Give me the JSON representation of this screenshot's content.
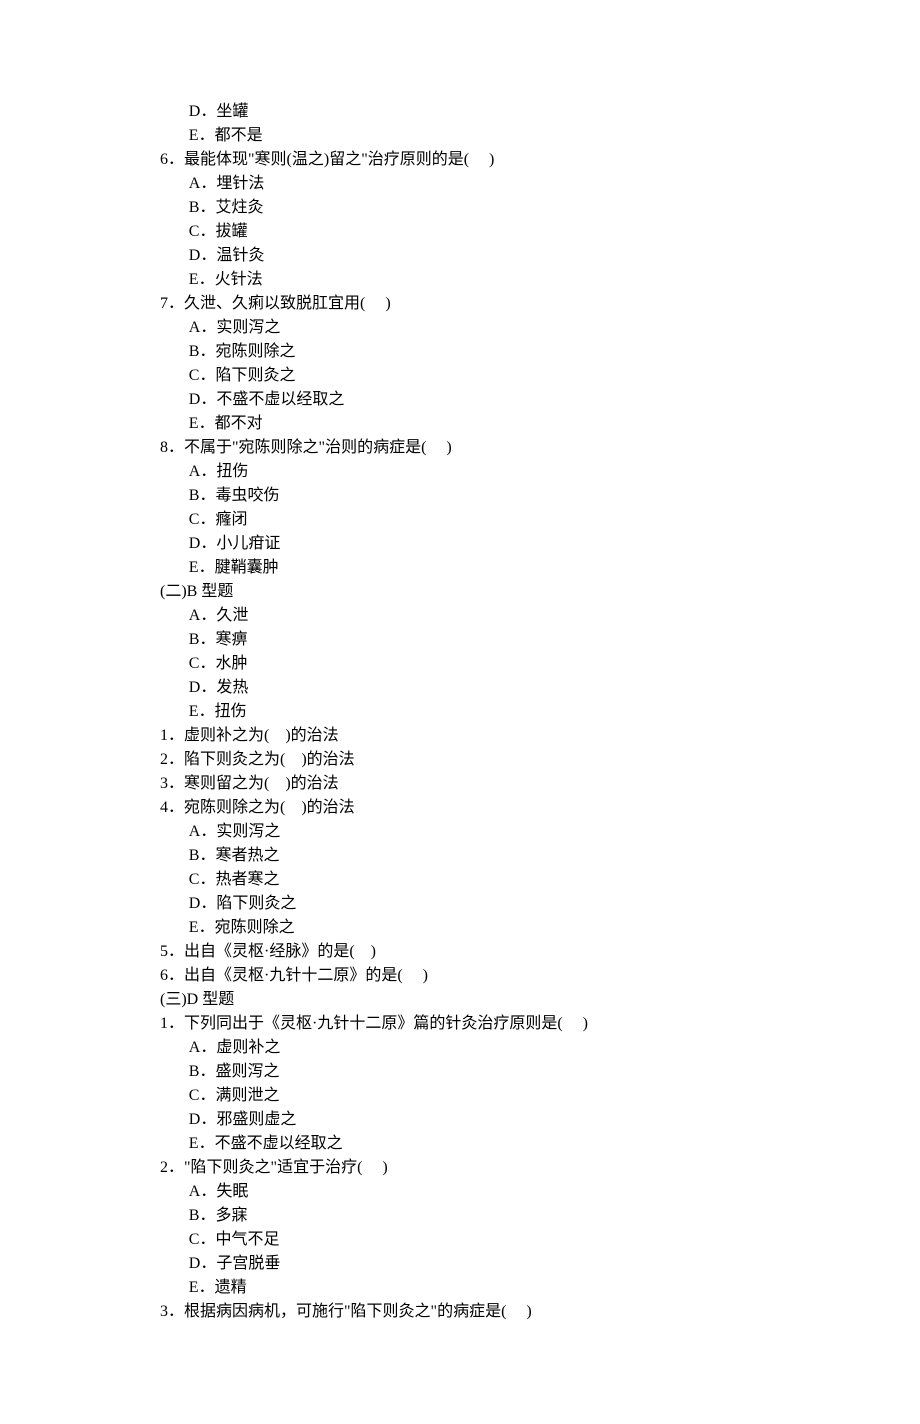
{
  "lines": [
    {
      "indent": 4,
      "text": "D．坐罐"
    },
    {
      "indent": 4,
      "text": "E．都不是"
    },
    {
      "indent": 0,
      "text": "6．最能体现\"寒则(温之)留之\"治疗原则的是(     )"
    },
    {
      "indent": 4,
      "text": "A．埋针法"
    },
    {
      "indent": 4,
      "text": "B．艾炷灸"
    },
    {
      "indent": 4,
      "text": "C．拔罐"
    },
    {
      "indent": 4,
      "text": "D．温针灸"
    },
    {
      "indent": 4,
      "text": "E．火针法"
    },
    {
      "indent": 0,
      "text": "7．久泄、久痢以致脱肛宜用(     )"
    },
    {
      "indent": 4,
      "text": "A．实则泻之"
    },
    {
      "indent": 4,
      "text": "B．宛陈则除之"
    },
    {
      "indent": 4,
      "text": "C．陷下则灸之"
    },
    {
      "indent": 4,
      "text": "D．不盛不虚以经取之"
    },
    {
      "indent": 4,
      "text": "E．都不对"
    },
    {
      "indent": 0,
      "text": "8．不属于\"宛陈则除之\"治则的病症是(     )"
    },
    {
      "indent": 4,
      "text": "A．扭伤"
    },
    {
      "indent": 4,
      "text": "B．毒虫咬伤"
    },
    {
      "indent": 4,
      "text": "C．癃闭"
    },
    {
      "indent": 4,
      "text": "D．小儿疳证"
    },
    {
      "indent": 4,
      "text": "E．腱鞘囊肿"
    },
    {
      "indent": 0,
      "text": "(二)B 型题"
    },
    {
      "indent": 4,
      "text": "A．久泄"
    },
    {
      "indent": 4,
      "text": "B．寒痹"
    },
    {
      "indent": 4,
      "text": "C．水肿"
    },
    {
      "indent": 4,
      "text": "D．发热"
    },
    {
      "indent": 4,
      "text": "E．扭伤"
    },
    {
      "indent": 0,
      "text": "1．虚则补之为(    )的治法"
    },
    {
      "indent": 0,
      "text": "2．陷下则灸之为(    )的治法"
    },
    {
      "indent": 0,
      "text": "3．寒则留之为(    )的治法"
    },
    {
      "indent": 0,
      "text": "4．宛陈则除之为(    )的治法"
    },
    {
      "indent": 4,
      "text": "A．实则泻之"
    },
    {
      "indent": 4,
      "text": "B．寒者热之"
    },
    {
      "indent": 4,
      "text": "C．热者寒之"
    },
    {
      "indent": 4,
      "text": "D．陷下则灸之"
    },
    {
      "indent": 4,
      "text": "E．宛陈则除之"
    },
    {
      "indent": 0,
      "text": "5．出自《灵枢·经脉》的是(    )"
    },
    {
      "indent": 0,
      "text": "6．出自《灵枢·九针十二原》的是(     )"
    },
    {
      "indent": 0,
      "text": "(三)D 型题"
    },
    {
      "indent": 0,
      "text": "1．下列同出于《灵枢·九针十二原》篇的针灸治疗原则是(     )"
    },
    {
      "indent": 4,
      "text": "A．虚则补之"
    },
    {
      "indent": 4,
      "text": "B．盛则泻之"
    },
    {
      "indent": 4,
      "text": "C．满则泄之"
    },
    {
      "indent": 4,
      "text": "D．邪盛则虚之"
    },
    {
      "indent": 4,
      "text": "E．不盛不虚以经取之"
    },
    {
      "indent": 0,
      "text": "2．\"陷下则灸之\"适宜于治疗(     )"
    },
    {
      "indent": 4,
      "text": "A．失眠"
    },
    {
      "indent": 4,
      "text": "B．多寐"
    },
    {
      "indent": 4,
      "text": "C．中气不足"
    },
    {
      "indent": 4,
      "text": "D．子宫脱垂"
    },
    {
      "indent": 4,
      "text": "E．遗精"
    },
    {
      "indent": 0,
      "text": "3．根据病因病机，可施行\"陷下则灸之\"的病症是(     )"
    }
  ]
}
